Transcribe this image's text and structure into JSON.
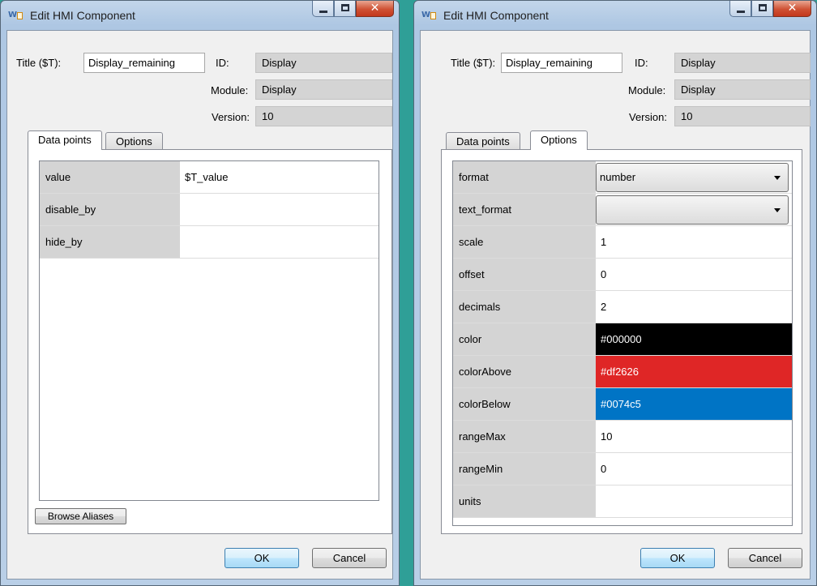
{
  "dialogs": [
    {
      "window_title": "Edit HMI Component",
      "app_icon": "wcc-app-icon",
      "caption_buttons": {
        "minimize": "minimize-icon",
        "maximize": "maximize-icon",
        "close": "close-icon"
      },
      "fields": {
        "title_label": "Title ($T):",
        "title_value": "Display_remaining",
        "id_label": "ID:",
        "id_value": "Display",
        "module_label": "Module:",
        "module_value": "Display",
        "version_label": "Version:",
        "version_value": "10"
      },
      "tabs": [
        {
          "label": "Data points",
          "active": true
        },
        {
          "label": "Options",
          "active": false
        }
      ],
      "rows": [
        {
          "key": "value",
          "value": "$T_value"
        },
        {
          "key": "disable_by",
          "value": ""
        },
        {
          "key": "hide_by",
          "value": ""
        }
      ],
      "browse_label": "Browse Aliases",
      "ok_label": "OK",
      "cancel_label": "Cancel"
    },
    {
      "window_title": "Edit HMI Component",
      "app_icon": "wcc-app-icon",
      "caption_buttons": {
        "minimize": "minimize-icon",
        "maximize": "maximize-icon",
        "close": "close-icon"
      },
      "fields": {
        "title_label": "Title ($T):",
        "title_value": "Display_remaining",
        "id_label": "ID:",
        "id_value": "Display",
        "module_label": "Module:",
        "module_value": "Display",
        "version_label": "Version:",
        "version_value": "10"
      },
      "tabs": [
        {
          "label": "Data points",
          "active": false
        },
        {
          "label": "Options",
          "active": true
        }
      ],
      "rows": [
        {
          "key": "format",
          "value": "number",
          "type": "combo"
        },
        {
          "key": "text_format",
          "value": "",
          "type": "combo"
        },
        {
          "key": "scale",
          "value": "1"
        },
        {
          "key": "offset",
          "value": "0"
        },
        {
          "key": "decimals",
          "value": "2"
        },
        {
          "key": "color",
          "value": "#000000",
          "bg": "#000000",
          "fg": "#ffffff"
        },
        {
          "key": "colorAbove",
          "value": "#df2626",
          "bg": "#df2626",
          "fg": "#ffffff"
        },
        {
          "key": "colorBelow",
          "value": "#0074c5",
          "bg": "#0074c5",
          "fg": "#ffffff"
        },
        {
          "key": "rangeMax",
          "value": "10"
        },
        {
          "key": "rangeMin",
          "value": "0"
        },
        {
          "key": "units",
          "value": ""
        }
      ],
      "ok_label": "OK",
      "cancel_label": "Cancel"
    }
  ],
  "theme": {
    "desktop": "#2f9f97",
    "key_column": "#d4d4d4"
  }
}
